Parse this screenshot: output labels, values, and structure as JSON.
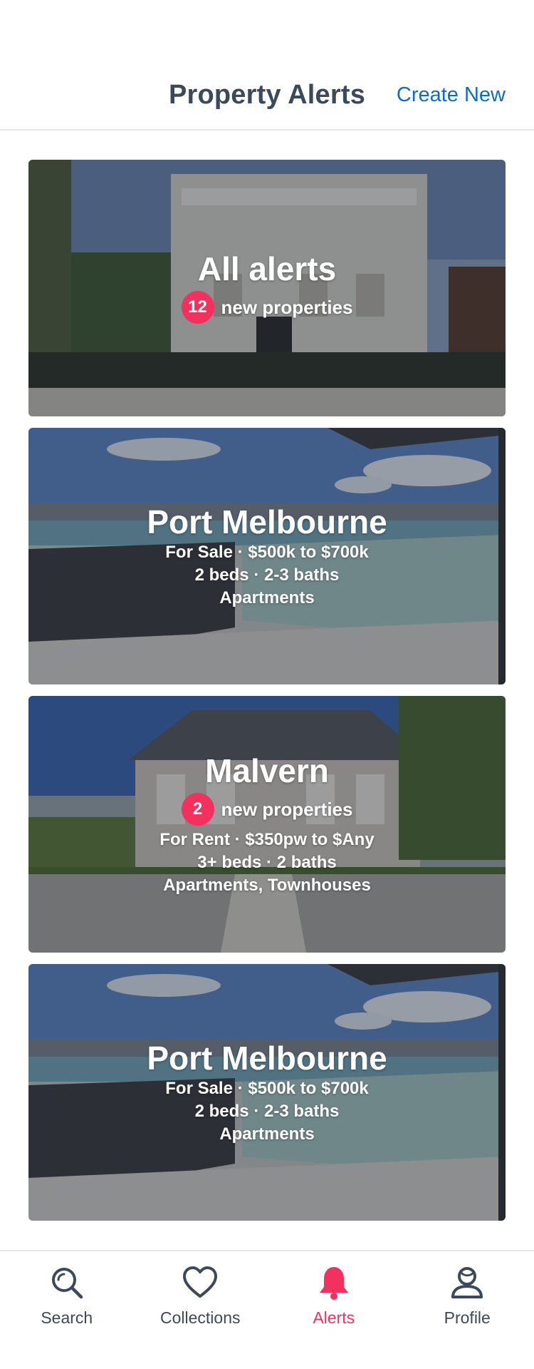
{
  "header": {
    "title": "Property Alerts",
    "create_label": "Create New"
  },
  "cards": [
    {
      "name": "All alerts",
      "badge": "12",
      "new_text": "new properties"
    },
    {
      "name": "Port Melbourne",
      "line1": "For Sale · $500k to $700k",
      "line2": "2 beds · 2-3 baths",
      "line3": "Apartments"
    },
    {
      "name": "Malvern",
      "badge": "2",
      "new_text": "new properties",
      "line1": "For Rent · $350pw to $Any",
      "line2": "3+ beds · 2 baths",
      "line3": "Apartments, Townhouses"
    },
    {
      "name": "Port Melbourne",
      "line1": "For Sale · $500k to $700k",
      "line2": "2 beds · 2-3 baths",
      "line3": "Apartments"
    }
  ],
  "tabs": [
    {
      "label": "Search",
      "icon": "search-icon"
    },
    {
      "label": "Collections",
      "icon": "heart-icon"
    },
    {
      "label": "Alerts",
      "icon": "bell-icon",
      "active": true
    },
    {
      "label": "Profile",
      "icon": "profile-icon"
    }
  ],
  "colors": {
    "accent": "#f2315f",
    "link": "#0b6ec5",
    "text": "#3b4a5a"
  }
}
